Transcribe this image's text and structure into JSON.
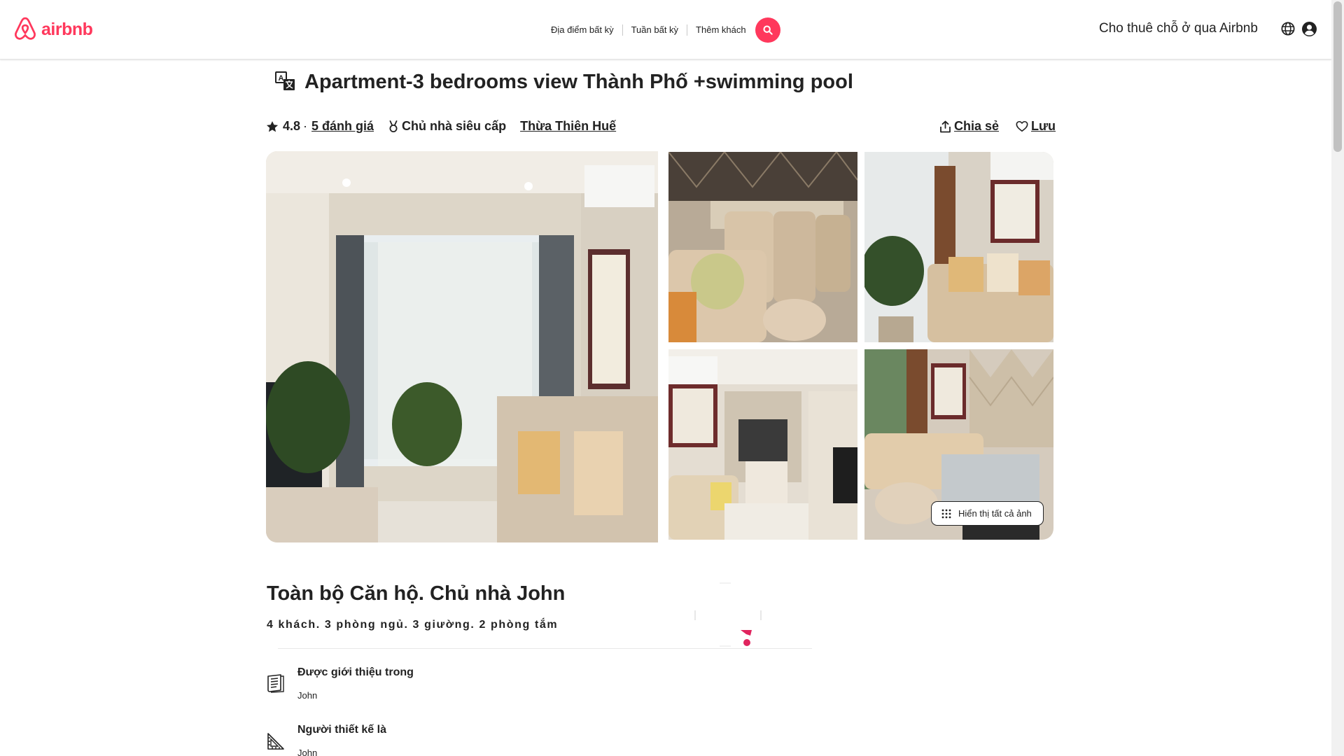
{
  "header": {
    "logo_text": "airbnb",
    "search": {
      "location": "Địa điểm bất kỳ",
      "week": "Tuần bất kỳ",
      "guests": "Thêm khách"
    },
    "host_link": "Cho thuê chỗ ở qua Airbnb",
    "brand_color": "#ff385c"
  },
  "listing": {
    "title": "Apartment-3 bedrooms view Thành Phố +swimming pool",
    "rating": "4.8",
    "rating_separator": "·",
    "reviews": "5 đánh giá",
    "superhost": "Chủ nhà siêu cấp",
    "location": "Thừa Thiên Huế",
    "share": "Chia sẻ",
    "save": "Lưu"
  },
  "gallery": {
    "show_all": "Hiển thị tất cả ảnh",
    "photos": [
      "living-room",
      "dining-area",
      "sofa-corner",
      "hallway-kitchen",
      "living-dining"
    ]
  },
  "summary": {
    "title": "Toàn bộ Căn hộ. Chủ nhà John",
    "details": "4 khách. 3 phòng ngủ. 3 giường. 2 phòng tắm"
  },
  "features": [
    {
      "title": "Được giới thiệu trong",
      "subtitle": "John",
      "icon": "book-icon"
    },
    {
      "title": "Người thiết kế là",
      "subtitle": "John",
      "icon": "ruler-icon"
    }
  ]
}
